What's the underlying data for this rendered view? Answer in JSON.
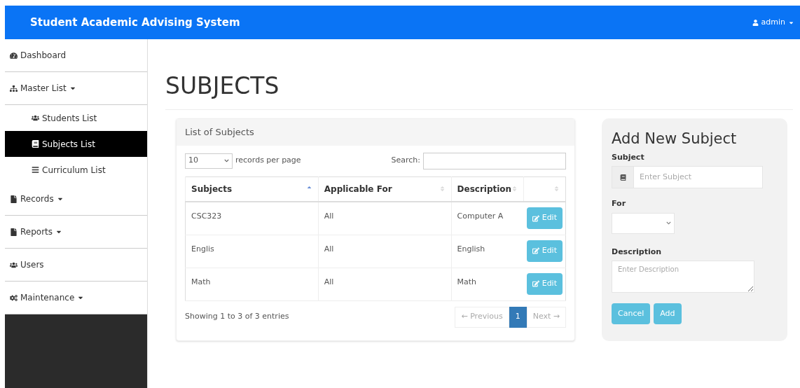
{
  "navbar": {
    "title": "Student Academic Advising System",
    "user": "admin"
  },
  "sidebar": {
    "items": [
      {
        "label": "Dashboard",
        "kind": "link",
        "selected": false
      },
      {
        "label": "Master List",
        "kind": "dropdown",
        "selected": false,
        "children": [
          {
            "label": "Students List",
            "selected": false
          },
          {
            "label": "Subjects List",
            "selected": true
          },
          {
            "label": "Curriculum List",
            "selected": false
          }
        ]
      },
      {
        "label": "Records",
        "kind": "dropdown",
        "selected": false
      },
      {
        "label": "Reports",
        "kind": "dropdown",
        "selected": false
      },
      {
        "label": "Users",
        "kind": "link",
        "selected": false
      },
      {
        "label": "Maintenance",
        "kind": "dropdown",
        "selected": false
      }
    ]
  },
  "page_title": "SUBJECTS",
  "list_panel": {
    "title": "List of Subjects",
    "page_size": "10",
    "page_size_label": "records per page",
    "search_label": "Search:",
    "table": {
      "columns": [
        {
          "label": "Subjects",
          "sorted": true
        },
        {
          "label": "Applicable For",
          "sorted": false
        },
        {
          "label": "Description",
          "sorted": false
        },
        {
          "sorted": false
        }
      ],
      "rows": [
        {
          "subject": "CSC323",
          "applicable_for": "All",
          "description": "Computer A",
          "action": "Edit"
        },
        {
          "subject": "Englis",
          "applicable_for": "All",
          "description": "English",
          "action": "Edit"
        },
        {
          "subject": "Math",
          "applicable_for": "All",
          "description": "Math",
          "action": "Edit"
        }
      ]
    },
    "info": "Showing 1 to 3 of 3 entries",
    "pagination": [
      {
        "label": "← Previous",
        "selected": false
      },
      {
        "label": "1",
        "selected": true
      },
      {
        "label": "Next →",
        "selected": false
      }
    ]
  },
  "form": {
    "title": "Add New Subject",
    "subject_label": "Subject",
    "subject_placeholder": "Enter Subject",
    "for_label": "For",
    "description_label": "Description",
    "description_placeholder": "Enter Description",
    "buttons": [
      "Cancel",
      "Add"
    ]
  }
}
